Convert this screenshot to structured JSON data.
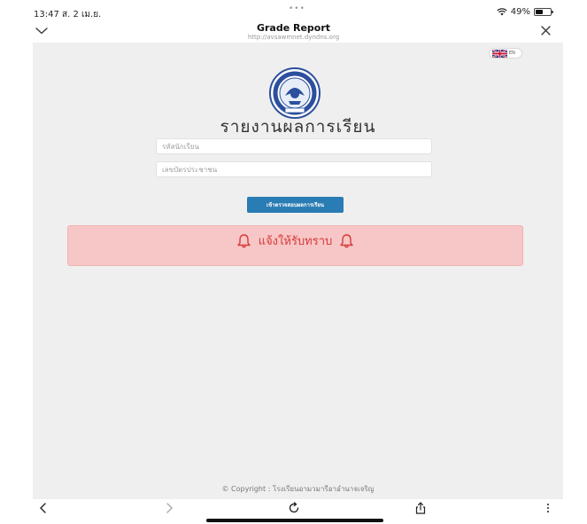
{
  "status_bar": {
    "time": "13:47  ส. 2 เม.ย.",
    "dots": "•••",
    "battery": "49%"
  },
  "browser": {
    "title": "Grade Report",
    "url": "http://avsawmnet.dyndns.org"
  },
  "page": {
    "lang_label": "EN",
    "title": "รายงานผลการเรียน",
    "student_id_placeholder": "รหัสนักเรียน",
    "id_card_placeholder": "เลขบัตรประชาชน",
    "submit_label": "เข้าตรวจสอบผลการเรียน",
    "alert_text": "แจ้งให้รับทราบ",
    "copyright": "© Copyright : โรงเรียนอามวมารีอาอำนาจเจริญ"
  },
  "colors": {
    "page_bg": "#efefef",
    "button": "#2a7cb4",
    "alert_bg": "#f7c6c6",
    "alert_text": "#d63a3a"
  },
  "icons": [
    "chevron-down-icon",
    "close-icon",
    "wifi-icon",
    "battery-icon",
    "uk-flag-icon",
    "school-logo",
    "bell-icon",
    "back-icon",
    "forward-icon",
    "reload-icon",
    "share-icon",
    "more-icon"
  ]
}
